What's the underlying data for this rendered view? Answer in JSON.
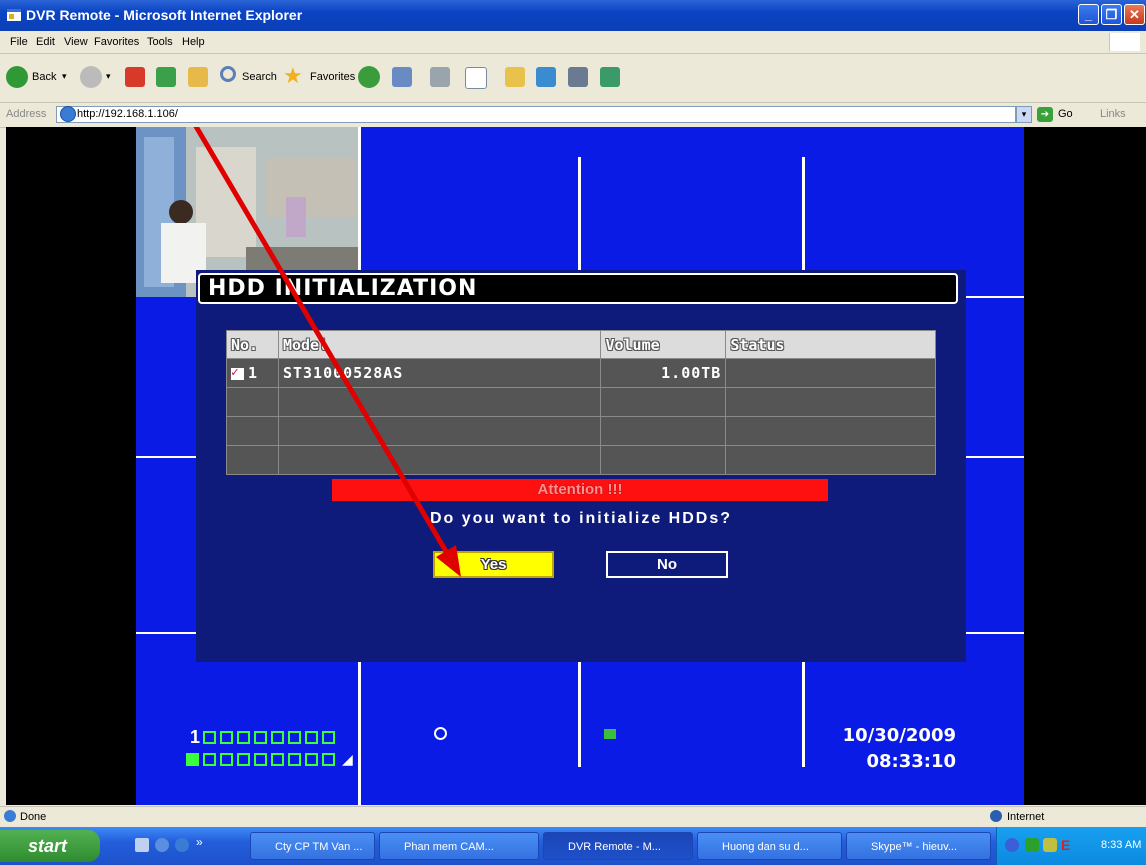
{
  "window": {
    "title": "DVR Remote - Microsoft Internet Explorer"
  },
  "menu": [
    "File",
    "Edit",
    "View",
    "Favorites",
    "Tools",
    "Help"
  ],
  "toolbar": {
    "back": "Back",
    "search": "Search",
    "favorites": "Favorites"
  },
  "address": {
    "label": "Address",
    "url": "http://192.168.1.106/",
    "go": "Go",
    "links": "Links"
  },
  "dvr": {
    "dialog_title": "HDD INITIALIZATION",
    "table": {
      "headers": [
        "No.",
        "Model",
        "Volume",
        "Status"
      ],
      "rows": [
        {
          "no": "1",
          "model": "ST31000528AS",
          "volume": "1.00TB",
          "status": ""
        }
      ]
    },
    "attention": "Attention !!!",
    "question": "Do you want to initialize HDDs?",
    "yes": "Yes",
    "no": "No",
    "channel_number": "1",
    "date": "10/30/2009",
    "time": "08:33:10"
  },
  "statusbar": {
    "status": "Done",
    "zone": "Internet"
  },
  "taskbar": {
    "start": "start",
    "tasks": [
      "Cty CP TM Van ...",
      "Phan mem CAM...",
      "DVR Remote - M...",
      "Huong dan su d...",
      "Skype™ - hieuv..."
    ],
    "clock": "8:33 AM"
  }
}
